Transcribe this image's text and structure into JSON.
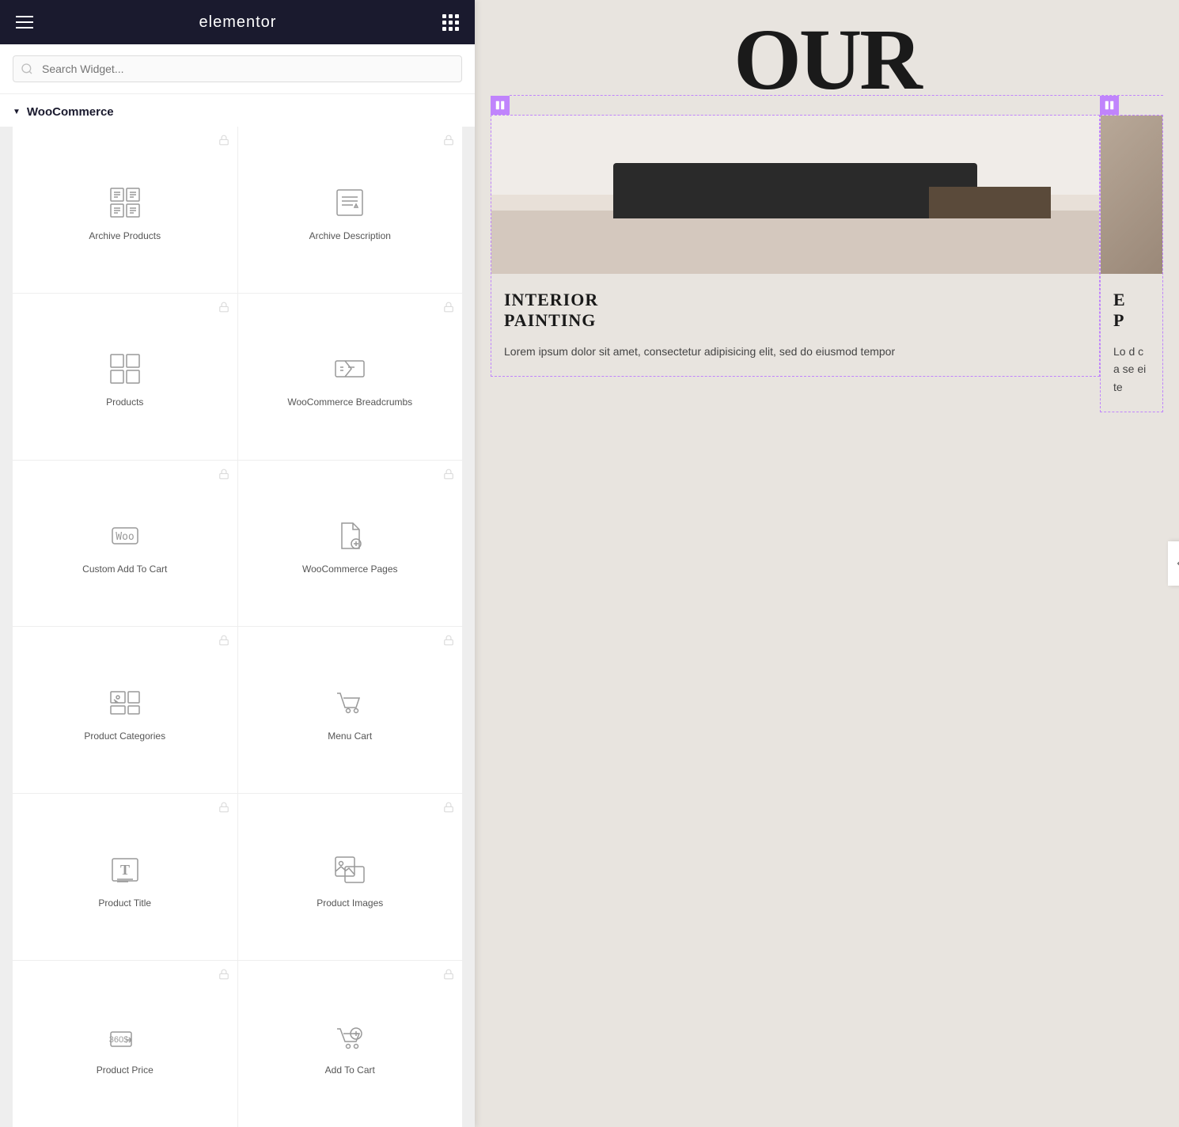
{
  "topbar": {
    "title": "elementor"
  },
  "search": {
    "placeholder": "Search Widget..."
  },
  "section": {
    "label": "WooCommerce"
  },
  "widgets": [
    {
      "id": "archive-products",
      "label": "Archive Products",
      "icon": "archive-products-icon"
    },
    {
      "id": "archive-description",
      "label": "Archive Description",
      "icon": "archive-description-icon"
    },
    {
      "id": "products",
      "label": "Products",
      "icon": "products-icon"
    },
    {
      "id": "woocommerce-breadcrumbs",
      "label": "WooCommerce Breadcrumbs",
      "icon": "breadcrumbs-icon"
    },
    {
      "id": "custom-add-to-cart",
      "label": "Custom Add To Cart",
      "icon": "custom-add-to-cart-icon"
    },
    {
      "id": "woocommerce-pages",
      "label": "WooCommerce Pages",
      "icon": "woocommerce-pages-icon"
    },
    {
      "id": "product-categories",
      "label": "Product Categories",
      "icon": "product-categories-icon"
    },
    {
      "id": "menu-cart",
      "label": "Menu Cart",
      "icon": "menu-cart-icon"
    },
    {
      "id": "product-title",
      "label": "Product Title",
      "icon": "product-title-icon"
    },
    {
      "id": "product-images",
      "label": "Product Images",
      "icon": "product-images-icon"
    },
    {
      "id": "product-price",
      "label": "Product Price",
      "icon": "product-price-icon"
    },
    {
      "id": "add-to-cart",
      "label": "Add To Cart",
      "icon": "add-to-cart-icon"
    }
  ],
  "canvas": {
    "heading": "OUR",
    "product1": {
      "title": "INTERIOR\nPAINTING",
      "description": "Lorem ipsum dolor sit amet, consectetur adipisicing elit, sed do eiusmod tempor"
    },
    "product2": {
      "title": "E\nP",
      "description": "Lo d c a se ei te"
    }
  }
}
